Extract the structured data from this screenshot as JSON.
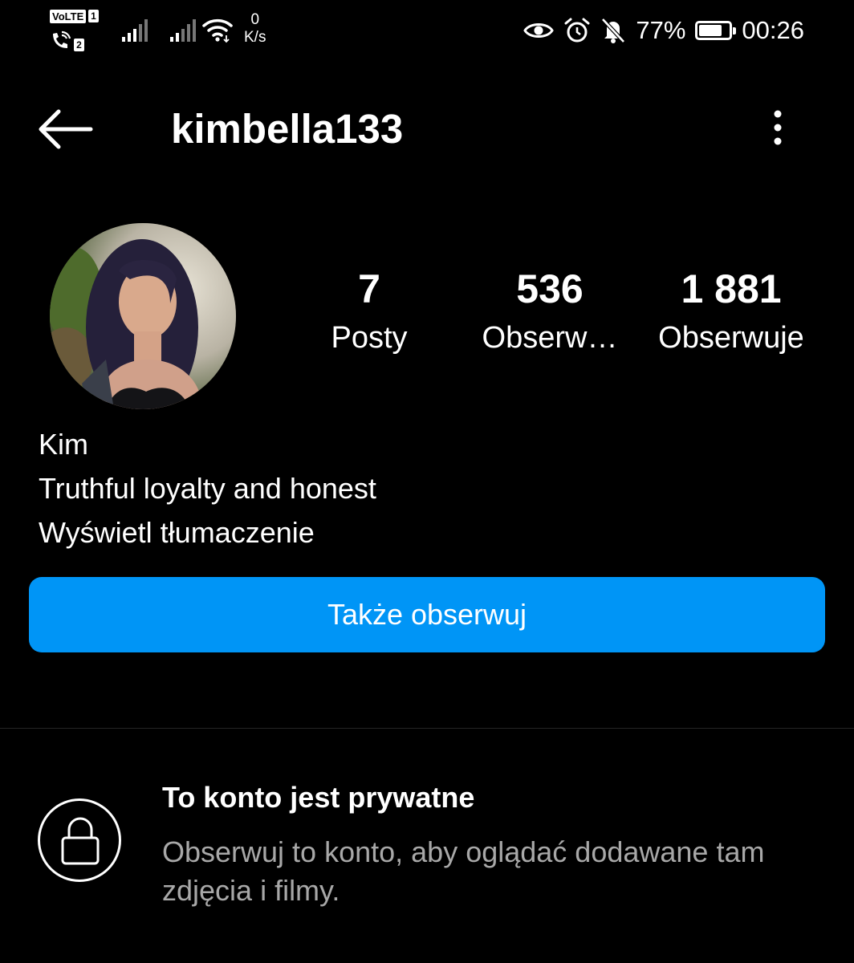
{
  "status_bar": {
    "volte": "VoLTE",
    "sim1": "1",
    "sim2": "2",
    "net_speed_value": "0",
    "net_speed_unit": "K/s",
    "battery_percent": "77%",
    "battery_level": 0.77,
    "time": "00:26"
  },
  "header": {
    "username": "kimbella133"
  },
  "profile": {
    "stats": {
      "posts": {
        "count": "7",
        "label": "Posty"
      },
      "followers": {
        "count": "536",
        "label": "Obserw…"
      },
      "following": {
        "count": "1 881",
        "label": "Obserwuje"
      }
    },
    "name": "Kim",
    "bio": "Truthful loyalty and honest",
    "translate_link": "Wyświetl tłumaczenie",
    "follow_button": "Także obserwuj"
  },
  "private_notice": {
    "title": "To konto jest prywatne",
    "description": "Obserwuj to konto, aby oglądać dodawane tam zdjęcia i filmy."
  },
  "colors": {
    "background": "#000000",
    "accent": "#0095f6",
    "secondary_text": "#a8a8a8",
    "divider": "#262626"
  },
  "icons": {
    "back": "arrow-left-icon",
    "more": "vertical-dots-icon",
    "lock": "lock-icon",
    "eye": "eye-icon",
    "alarm": "alarm-icon",
    "mute": "bell-off-icon",
    "wifi": "wifi-icon",
    "signal": "signal-bars-icon"
  }
}
